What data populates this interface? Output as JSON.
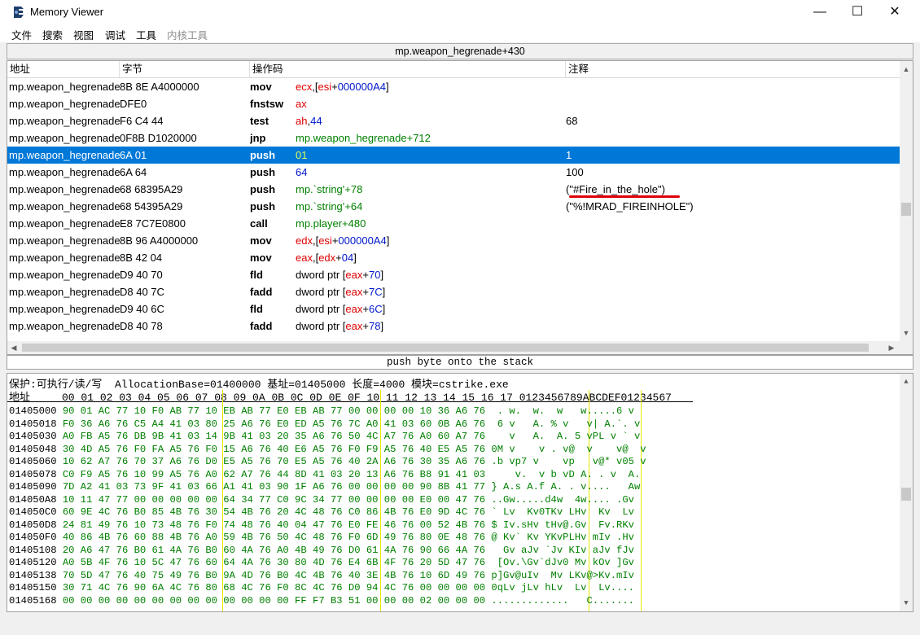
{
  "window": {
    "title": "Memory Viewer",
    "minimize": "—",
    "maximize": "☐",
    "close": "✕"
  },
  "menu": [
    {
      "label": "文件",
      "enabled": true
    },
    {
      "label": "搜索",
      "enabled": true
    },
    {
      "label": "视图",
      "enabled": true
    },
    {
      "label": "调试",
      "enabled": true
    },
    {
      "label": "工具",
      "enabled": true
    },
    {
      "label": "内核工具",
      "enabled": false
    }
  ],
  "disassembler": {
    "address_bar": "mp.weapon_hegrenade+430",
    "columns": {
      "address": "地址",
      "bytes": "字节",
      "opcode": "操作码",
      "comment": "注释"
    },
    "rows": [
      {
        "addr": "mp.weapon_hegrenade",
        "bytes": "8B 8E A4000000",
        "op": "mov",
        "args": [
          [
            "reg",
            "ecx"
          ],
          [
            "plain",
            ",["
          ],
          [
            "reg",
            "esi"
          ],
          [
            "plain",
            "+"
          ],
          [
            "num",
            "000000A4"
          ],
          [
            "plain",
            "]"
          ]
        ],
        "comment": ""
      },
      {
        "addr": "mp.weapon_hegrenade",
        "bytes": "DFE0",
        "op": "fnstsw",
        "args": [
          [
            "reg",
            "ax"
          ]
        ],
        "comment": ""
      },
      {
        "addr": "mp.weapon_hegrenade",
        "bytes": "F6 C4 44",
        "op": "test",
        "args": [
          [
            "reg",
            "ah"
          ],
          [
            "plain",
            ","
          ],
          [
            "num",
            "44"
          ]
        ],
        "comment": "68"
      },
      {
        "addr": "mp.weapon_hegrenade",
        "bytes": "0F8B D1020000",
        "op": "jnp",
        "args": [
          [
            "sym",
            "mp.weapon_hegrenade+712"
          ]
        ],
        "comment": ""
      },
      {
        "addr": "mp.weapon_hegrenade",
        "bytes": "6A 01",
        "op": "push",
        "args": [
          [
            "num",
            "01"
          ]
        ],
        "comment": "1",
        "selected": true
      },
      {
        "addr": "mp.weapon_hegrenade",
        "bytes": "6A 64",
        "op": "push",
        "args": [
          [
            "num",
            "64"
          ]
        ],
        "comment": "100"
      },
      {
        "addr": "mp.weapon_hegrenade",
        "bytes": "68 68395A29",
        "op": "push",
        "args": [
          [
            "sym",
            "mp.`string'+78"
          ]
        ],
        "comment": "(\"#Fire_in_the_hole\")"
      },
      {
        "addr": "mp.weapon_hegrenade",
        "bytes": "68 54395A29",
        "op": "push",
        "args": [
          [
            "sym",
            "mp.`string'+64"
          ]
        ],
        "comment": "(\"%!MRAD_FIREINHOLE\")"
      },
      {
        "addr": "mp.weapon_hegrenade",
        "bytes": "E8 7C7E0800",
        "op": "call",
        "args": [
          [
            "sym",
            "mp.player+480"
          ]
        ],
        "comment": ""
      },
      {
        "addr": "mp.weapon_hegrenade",
        "bytes": "8B 96 A4000000",
        "op": "mov",
        "args": [
          [
            "reg",
            "edx"
          ],
          [
            "plain",
            ",["
          ],
          [
            "reg",
            "esi"
          ],
          [
            "plain",
            "+"
          ],
          [
            "num",
            "000000A4"
          ],
          [
            "plain",
            "]"
          ]
        ],
        "comment": ""
      },
      {
        "addr": "mp.weapon_hegrenade",
        "bytes": "8B 42 04",
        "op": "mov",
        "args": [
          [
            "reg",
            "eax"
          ],
          [
            "plain",
            ",["
          ],
          [
            "reg",
            "edx"
          ],
          [
            "plain",
            "+"
          ],
          [
            "num",
            "04"
          ],
          [
            "plain",
            "]"
          ]
        ],
        "comment": ""
      },
      {
        "addr": "mp.weapon_hegrenade",
        "bytes": "D9 40 70",
        "op": "fld",
        "args": [
          [
            "plain",
            "dword ptr ["
          ],
          [
            "reg",
            "eax"
          ],
          [
            "plain",
            "+"
          ],
          [
            "num",
            "70"
          ],
          [
            "plain",
            "]"
          ]
        ],
        "comment": ""
      },
      {
        "addr": "mp.weapon_hegrenade",
        "bytes": "D8 40 7C",
        "op": "fadd",
        "args": [
          [
            "plain",
            "dword ptr ["
          ],
          [
            "reg",
            "eax"
          ],
          [
            "plain",
            "+"
          ],
          [
            "num",
            "7C"
          ],
          [
            "plain",
            "]"
          ]
        ],
        "comment": ""
      },
      {
        "addr": "mp.weapon_hegrenade",
        "bytes": "D9 40 6C",
        "op": "fld",
        "args": [
          [
            "plain",
            "dword ptr ["
          ],
          [
            "reg",
            "eax"
          ],
          [
            "plain",
            "+"
          ],
          [
            "num",
            "6C"
          ],
          [
            "plain",
            "]"
          ]
        ],
        "comment": ""
      },
      {
        "addr": "mp.weapon_hegrenade",
        "bytes": "D8 40 78",
        "op": "fadd",
        "args": [
          [
            "plain",
            "dword ptr ["
          ],
          [
            "reg",
            "eax"
          ],
          [
            "plain",
            "+"
          ],
          [
            "num",
            "78"
          ],
          [
            "plain",
            "]"
          ]
        ],
        "comment": ""
      }
    ],
    "status": "push byte onto the stack"
  },
  "hex": {
    "info": "保护:可执行/读/写  AllocationBase=01400000 基址=01405000 长度=4000 模块=cstrike.exe",
    "header": "地址     00 01 02 03 04 05 06 07 08 09 0A 0B 0C 0D 0E 0F 10 11 12 13 14 15 16 17 0123456789ABCDEF01234567",
    "rows": [
      {
        "addr": "01405000",
        "bytes": "90 01 AC 77 10 F0 AB 77 10 EB AB 77 E0 EB AB 77 00 00 00 00 10 36 A6 76",
        "ascii": " . w.  w.  w   w.....6 v"
      },
      {
        "addr": "01405018",
        "bytes": "F0 36 A6 76 C5 A4 41 03 80 25 A6 76 E0 ED A5 76 7C A0 41 03 60 0B A6 76",
        "ascii": " 6 v   A. % v   v| A.`. v"
      },
      {
        "addr": "01405030",
        "bytes": "A0 FB A5 76 DB 9B 41 03 14 9B 41 03 20 35 A6 76 50 4C A7 76 A0 60 A7 76",
        "ascii": "   v   A.  A. 5 vPL v ` v"
      },
      {
        "addr": "01405048",
        "bytes": "30 4D A5 76 F0 FA A5 76 F0 15 A6 76 40 E6 A5 76 F0 F9 A5 76 40 E5 A5 76",
        "ascii": "0M v    v . v@  v    v@  v"
      },
      {
        "addr": "01405060",
        "bytes": "10 62 A7 76 70 37 A6 76 D0 E5 A5 76 70 E5 A5 76 40 2A A6 76 30 35 A6 76",
        "ascii": ".b vp7 v    vp   v@* v05 v"
      },
      {
        "addr": "01405078",
        "bytes": "C0 F9 A5 76 10 99 A5 76 A0 62 A7 76 44 8D 41 03 20 13 A6 76 B8 91 41 03",
        "ascii": "    v.  v b vD A. . v  A."
      },
      {
        "addr": "01405090",
        "bytes": "7D A2 41 03 73 9F 41 03 66 A1 41 03 90 1F A6 76 00 00 00 00 90 8B 41 77",
        "ascii": "} A.s A.f A. . v....   Aw"
      },
      {
        "addr": "014050A8",
        "bytes": "10 11 47 77 00 00 00 00 00 64 34 77 C0 9C 34 77 00 00 00 00 E0 00 47 76",
        "ascii": "..Gw.....d4w  4w.... .Gv"
      },
      {
        "addr": "014050C0",
        "bytes": "60 9E 4C 76 B0 85 4B 76 30 54 4B 76 20 4C 48 76 C0 86 4B 76 E0 9D 4C 76",
        "ascii": "` Lv  Kv0TKv LHv  Kv  Lv"
      },
      {
        "addr": "014050D8",
        "bytes": "24 81 49 76 10 73 48 76 F0 74 48 76 40 04 47 76 E0 FE 46 76 00 52 4B 76",
        "ascii": "$ Iv.sHv tHv@.Gv  Fv.RKv"
      },
      {
        "addr": "014050F0",
        "bytes": "40 86 4B 76 60 88 4B 76 A0 59 4B 76 50 4C 48 76 F0 6D 49 76 80 0E 48 76",
        "ascii": "@ Kv` Kv YKvPLHv mIv .Hv"
      },
      {
        "addr": "01405108",
        "bytes": "20 A6 47 76 B0 61 4A 76 B0 60 4A 76 A0 4B 49 76 D0 61 4A 76 90 66 4A 76",
        "ascii": "  Gv aJv `Jv KIv aJv fJv"
      },
      {
        "addr": "01405120",
        "bytes": "A0 5B 4F 76 10 5C 47 76 60 64 4A 76 30 80 4D 76 E4 6B 4F 76 20 5D 47 76",
        "ascii": " [Ov.\\Gv`dJv0 Mv kOv ]Gv"
      },
      {
        "addr": "01405138",
        "bytes": "70 5D 47 76 40 75 49 76 B0 9A 4D 76 B0 4C 4B 76 40 3E 4B 76 10 6D 49 76",
        "ascii": "p]Gv@uIv  Mv LKv@>Kv.mIv"
      },
      {
        "addr": "01405150",
        "bytes": "30 71 4C 76 90 6A 4C 76 80 68 4C 76 F0 8C 4C 76 D0 94 4C 76 00 00 00 00",
        "ascii": "0qLv jLv hLv  Lv  Lv...."
      },
      {
        "addr": "01405168",
        "bytes": "00 00 00 00 00 00 00 00 00 00 00 00 00 FF F7 B3 51 00 00 00 02 00 00 00",
        "ascii": ".............   C......."
      }
    ]
  }
}
